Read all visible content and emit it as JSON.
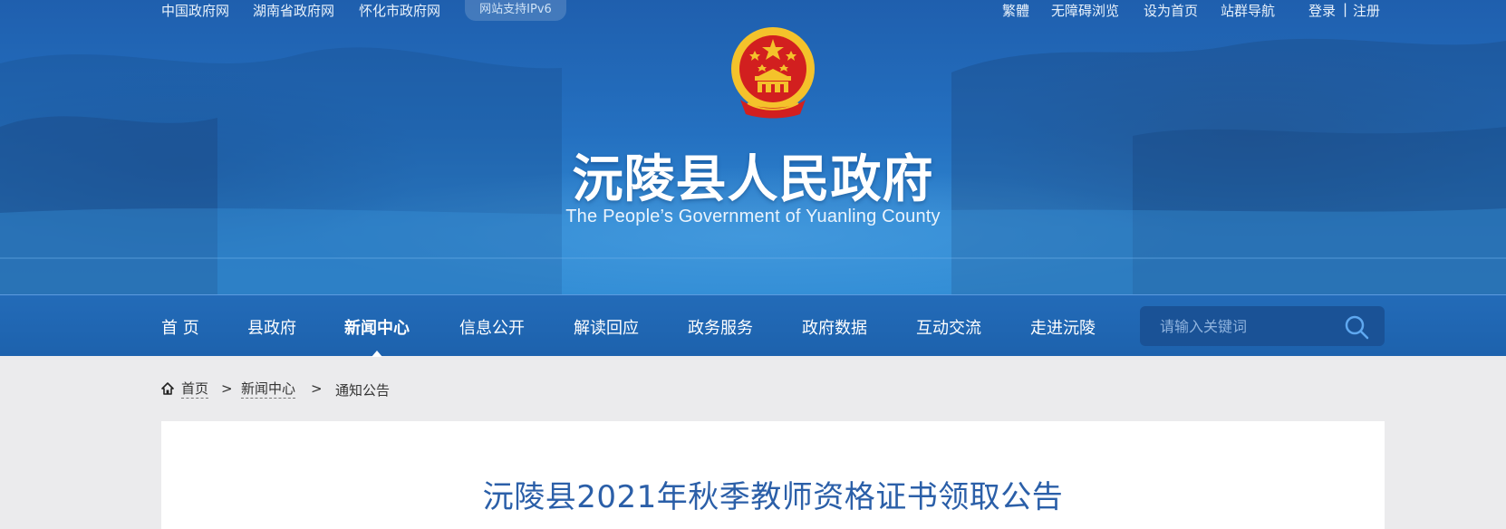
{
  "topbar": {
    "links_left": [
      "中国政府网",
      "湖南省政府网",
      "怀化市政府网"
    ],
    "ipv6_badge": "网站支持IPv6",
    "links_right": [
      "繁體",
      "无障碍浏览",
      "设为首页",
      "站群导航"
    ],
    "login": "登录",
    "separator": "|",
    "register": "注册"
  },
  "header": {
    "emblem_icon": "national-emblem-icon",
    "title": "沅陵县人民政府",
    "subtitle": "The People’s Government of Yuanling County"
  },
  "nav": {
    "items": [
      {
        "label": "首 页"
      },
      {
        "label": "县政府"
      },
      {
        "label": "新闻中心",
        "active": true
      },
      {
        "label": "信息公开"
      },
      {
        "label": "解读回应"
      },
      {
        "label": "政务服务"
      },
      {
        "label": "政府数据"
      },
      {
        "label": "互动交流"
      },
      {
        "label": "走进沅陵"
      }
    ],
    "search": {
      "placeholder": "请输入关键词",
      "icon": "search-icon"
    }
  },
  "breadcrumb": {
    "icon": "home-icon",
    "items": [
      "首页",
      "新闻中心",
      "通知公告"
    ],
    "separator": ">"
  },
  "article": {
    "title": "沅陵县2021年秋季教师资格证书领取公告"
  },
  "colors": {
    "nav_bg": "#1d62ad",
    "title_blue": "#2b5fa8",
    "page_bg": "#ebebed",
    "emblem_red": "#d21f1f",
    "emblem_gold": "#f4c22b"
  }
}
